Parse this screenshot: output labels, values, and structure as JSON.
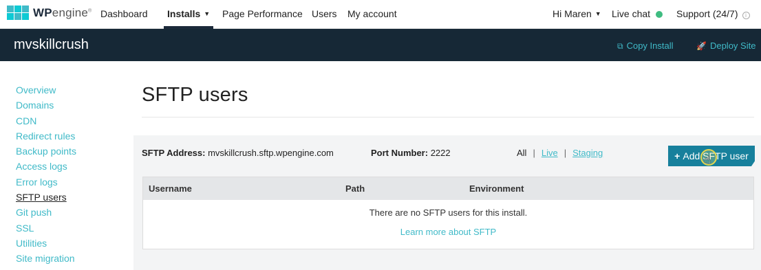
{
  "topnav": {
    "logo": {
      "brand_bold": "WP",
      "brand_light": "engine",
      "mark": "®"
    },
    "items": [
      {
        "label": "Dashboard"
      },
      {
        "label": "Installs"
      },
      {
        "label": "Page Performance"
      },
      {
        "label": "Users"
      },
      {
        "label": "My account"
      }
    ],
    "user_label": "Hi Maren",
    "live_chat_label": "Live chat",
    "support_label": "Support (24/7)",
    "status_color": "#3fbc81"
  },
  "site": {
    "name": "mvskillcrush",
    "copy_install_label": "Copy Install",
    "deploy_site_label": "Deploy Site",
    "header_bg": "#162836",
    "accent": "#40bac8"
  },
  "sidebar": {
    "items": [
      {
        "label": "Overview"
      },
      {
        "label": "Domains"
      },
      {
        "label": "CDN"
      },
      {
        "label": "Redirect rules"
      },
      {
        "label": "Backup points"
      },
      {
        "label": "Access logs"
      },
      {
        "label": "Error logs"
      },
      {
        "label": "SFTP users"
      },
      {
        "label": "Git push"
      },
      {
        "label": "SSL"
      },
      {
        "label": "Utilities"
      },
      {
        "label": "Site migration"
      }
    ],
    "current": "SFTP users"
  },
  "main": {
    "title": "SFTP users",
    "sftp_address_label": "SFTP Address:",
    "sftp_address_value": "mvskillcrush.sftp.wpengine.com",
    "port_label": "Port Number:",
    "port_value": "2222",
    "filters": {
      "all": "All",
      "sep": "|",
      "live": "Live",
      "staging": "Staging"
    },
    "add_button_label": "Add SFTP user",
    "add_button_color": "#17809c",
    "table": {
      "columns": [
        "Username",
        "Path",
        "Environment"
      ],
      "empty_message": "There are no SFTP users for this install.",
      "learn_more": "Learn more about SFTP"
    }
  }
}
